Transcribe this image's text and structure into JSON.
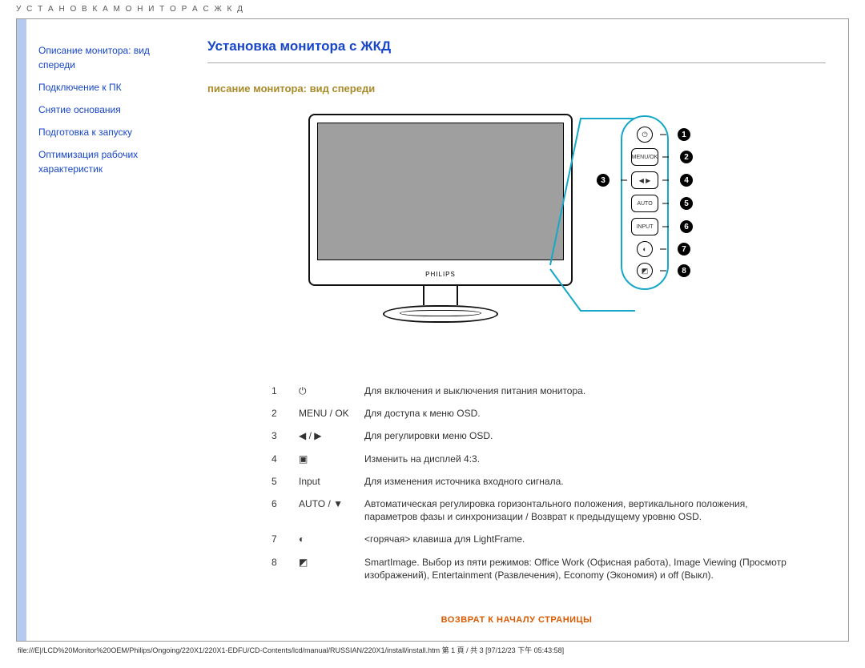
{
  "header_small": "У С Т А Н О В К А  М О Н И Т О Р А  С  Ж К Д",
  "sidebar": {
    "links": [
      "Описание монитора: вид спереди",
      "Подключение к ПК",
      "Снятие основания",
      "Подготовка к запуску",
      "Оптимизация рабочих характеристик"
    ]
  },
  "content": {
    "title": "Установка монитора с ЖКД",
    "subhead": "писание монитора: вид спереди",
    "brand": "PHILIPS",
    "controls": [
      {
        "num": "1",
        "icon_name": "power-icon",
        "icon_text": "⏻",
        "desc": "Для включения и выключения питания монитора."
      },
      {
        "num": "2",
        "icon_name": "menu-ok-icon",
        "icon_text": "MENU / OK",
        "desc": "Для доступа к меню OSD."
      },
      {
        "num": "3",
        "icon_name": "left-right-icon",
        "icon_text": "◀ / ▶",
        "desc": "Для регулировки меню OSD."
      },
      {
        "num": "4",
        "icon_name": "aspect-icon",
        "icon_text": "▣",
        "desc": "Изменить на дисплей 4:3."
      },
      {
        "num": "5",
        "icon_name": "input-icon",
        "icon_text": "Input",
        "desc": "Для изменения источника входного сигнала."
      },
      {
        "num": "6",
        "icon_name": "auto-down-icon",
        "icon_text": "AUTO / ▼",
        "desc": "Автоматическая регулировка горизонтального положения, вертикального положения, параметров фазы и синхронизации / Возврат к предыдущему уровню OSD."
      },
      {
        "num": "7",
        "icon_name": "lightframe-icon",
        "icon_text": "◐",
        "desc": "<горячая> клавиша для LightFrame."
      },
      {
        "num": "8",
        "icon_name": "smartimage-icon",
        "icon_text": "◩",
        "desc": "SmartImage. Выбор из пяти режимов: Office Work (Офисная работа), Image Viewing (Просмотр изображений), Entertainment (Развлечения), Economy (Экономия) и off (Выкл)."
      }
    ],
    "return_link": "ВОЗВРАТ К НАЧАЛУ СТРАНИЦЫ"
  },
  "panel_buttons": [
    {
      "label": "⏻",
      "num": "1",
      "style": "circle"
    },
    {
      "label": "MENU/OK",
      "num": "2"
    },
    {
      "label": "◀ ▶",
      "num": "4",
      "left_num": "3"
    },
    {
      "label": "AUTO",
      "num": "5"
    },
    {
      "label": "INPUT",
      "num": "6"
    },
    {
      "label": "◐",
      "num": "7",
      "style": "circle"
    },
    {
      "label": "◩",
      "num": "8",
      "style": "circle"
    }
  ],
  "footer_path": "file:///E|/LCD%20Monitor%20OEM/Philips/Ongoing/220X1/220X1-EDFU/CD-Contents/lcd/manual/RUSSIAN/220X1/install/install.htm 第 1 頁 / 共 3  [97/12/23 下午 05:43:58]"
}
